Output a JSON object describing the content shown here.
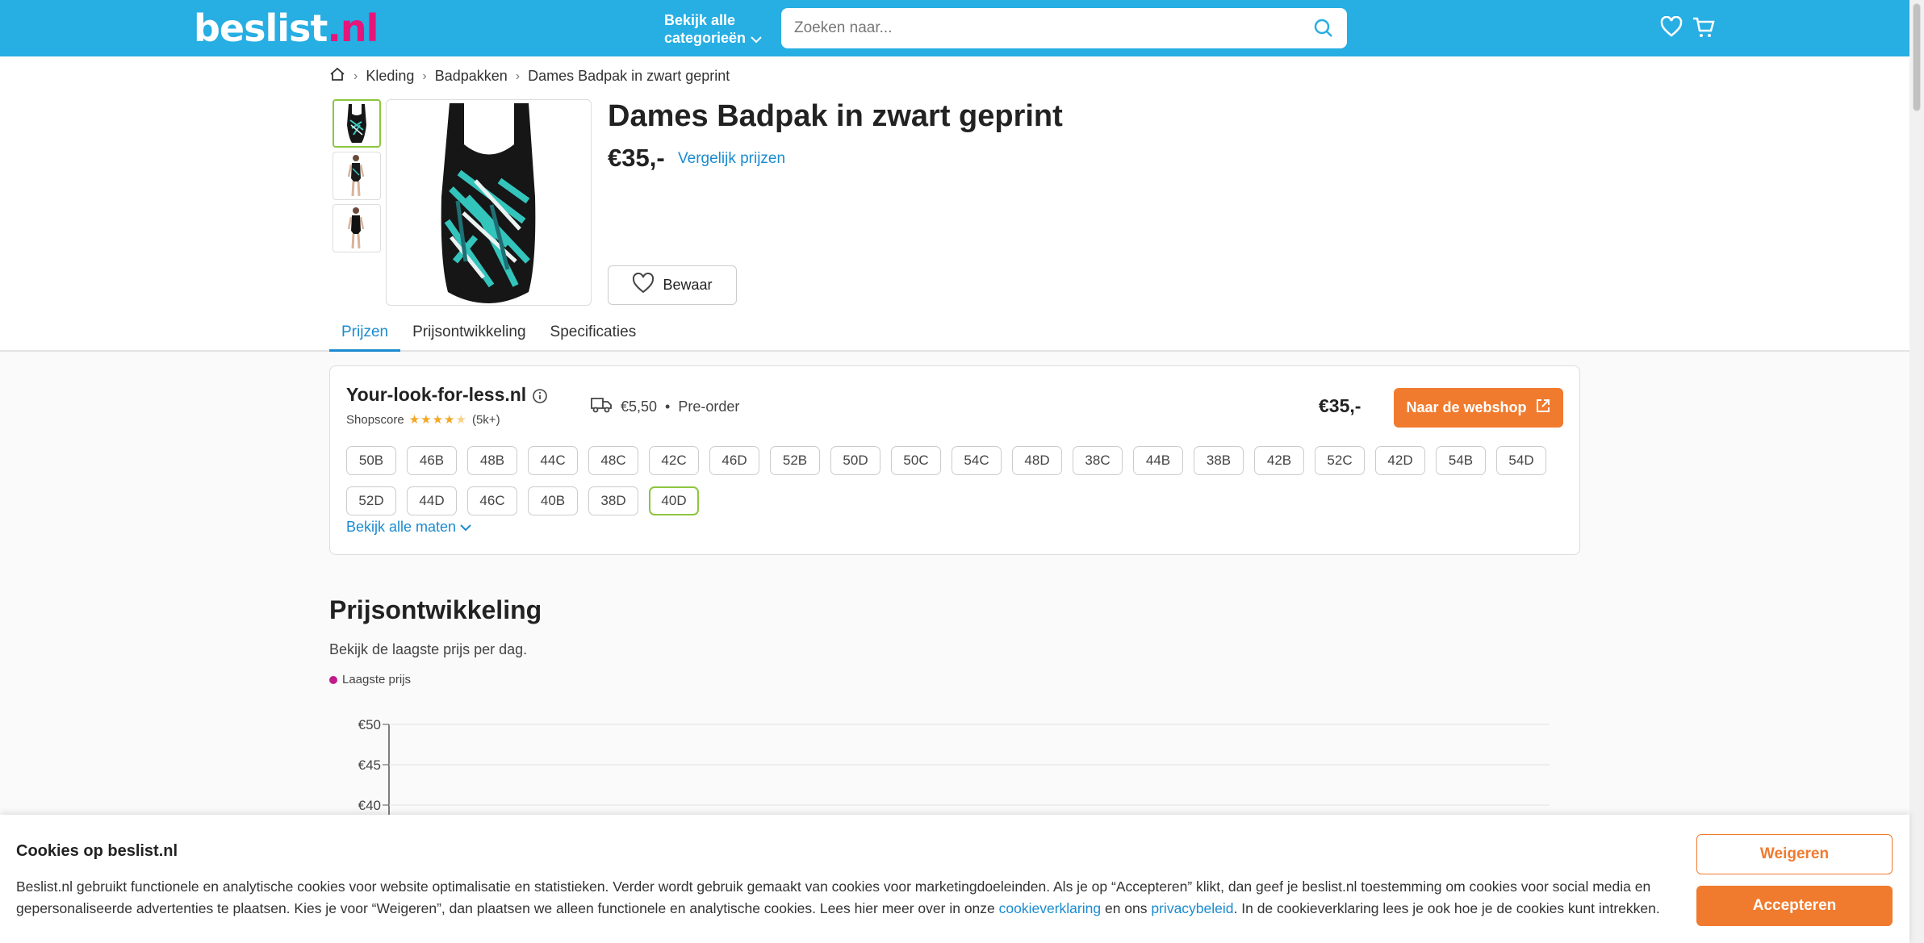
{
  "header": {
    "logo_main": "beslist",
    "logo_dot": ".",
    "logo_tld": "nl",
    "categories_line1": "Bekijk alle",
    "categories_line2": "categorieën",
    "search_placeholder": "Zoeken naar...",
    "icons": [
      "chevron-down-icon",
      "search-icon",
      "heart-icon",
      "cart-icon"
    ]
  },
  "breadcrumb": {
    "home_icon": "home-icon",
    "items": [
      "Kleding",
      "Badpakken",
      "Dames Badpak in zwart geprint"
    ]
  },
  "product": {
    "title": "Dames Badpak in zwart geprint",
    "price": "€35,-",
    "compare_label": "Vergelijk prijzen",
    "save_label": "Bewaar"
  },
  "tabs": [
    "Prijzen",
    "Prijsontwikkeling",
    "Specificaties"
  ],
  "offer": {
    "shop_name": "Your-look-for-less.nl",
    "shopscore_label": "Shopscore",
    "rating": 4.5,
    "review_count": "(5k+)",
    "shipping_cost": "€5,50",
    "bullet": "•",
    "availability": "Pre-order",
    "price": "€35,-",
    "webshop_label": "Naar de webshop",
    "sizes": [
      "50B",
      "46B",
      "48B",
      "44C",
      "48C",
      "42C",
      "46D",
      "52B",
      "50D",
      "50C",
      "54C",
      "48D",
      "38C",
      "44B",
      "38B",
      "42B",
      "52C",
      "42D",
      "54B",
      "54D",
      "52D",
      "44D",
      "46C",
      "40B",
      "38D",
      "40D"
    ],
    "selected_size": "40D",
    "all_sizes_label": "Bekijk alle maten"
  },
  "price_history": {
    "title": "Prijsontwikkeling",
    "subtitle": "Bekijk de laagste prijs per dag.",
    "legend_label": "Laagste prijs",
    "legend_color": "#c01a8c"
  },
  "chart_data": {
    "type": "line",
    "title": "",
    "xlabel": "",
    "ylabel": "",
    "y_ticks": [
      "€50",
      "€45",
      "€40"
    ],
    "series": [
      {
        "name": "Laagste prijs",
        "values": []
      }
    ],
    "grid": true
  },
  "cookie": {
    "title": "Cookies op beslist.nl",
    "text_1": "Beslist.nl gebruikt functionele en analytische cookies voor website optimalisatie en statistieken. Verder wordt gebruik gemaakt van cookies voor marketingdoeleinden. Als je op “Accepteren” klikt, dan geef je beslist.nl toestemming om cookies voor social media en gepersonaliseerde advertenties te plaatsen. Kies je voor “Weigeren”, dan plaatsen we alleen functionele en analytische cookies. Lees hier meer over in onze ",
    "link_1": "cookieverklaring",
    "text_2": " en ons ",
    "link_2": "privacybeleid",
    "text_3": ". In de cookieverklaring lees je ook hoe je de cookies kunt intrekken.",
    "refuse_label": "Weigeren",
    "accept_label": "Accepteren"
  },
  "colors": {
    "header": "#27aee3",
    "accent_orange": "#f07b2e",
    "link_blue": "#1a8bd0",
    "logo_pink": "#e6157a",
    "selected_green": "#8dc63f"
  }
}
